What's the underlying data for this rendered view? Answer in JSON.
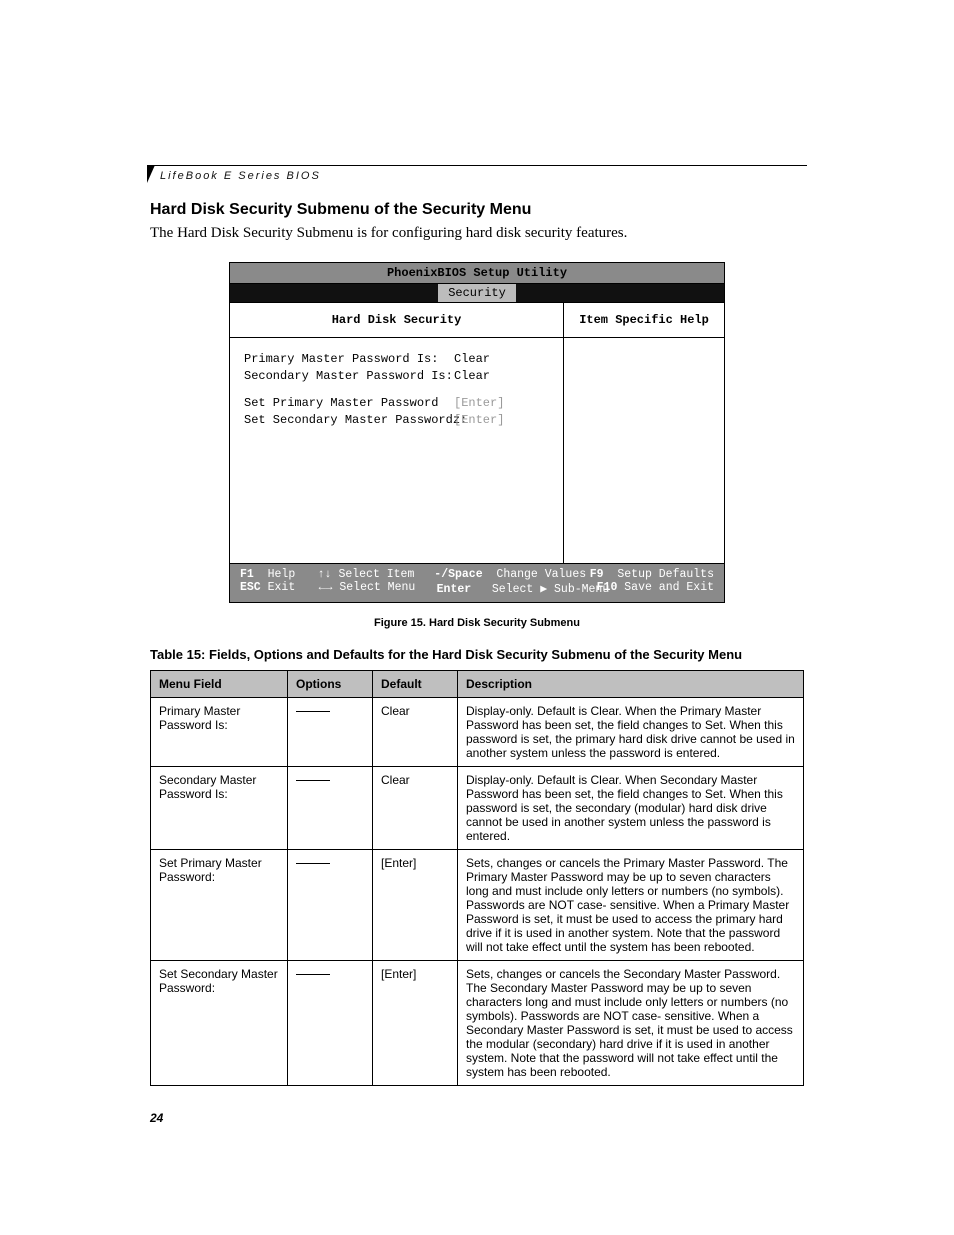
{
  "running_head": "LifeBook E Series BIOS",
  "section_title": "Hard Disk Security Submenu of the Security Menu",
  "intro": "The Hard Disk Security Submenu is for configuring hard disk security features.",
  "bios": {
    "utility_title": "PhoenixBIOS Setup Utility",
    "tab": "Security",
    "panel_title": "Hard Disk Security",
    "help_title": "Item Specific Help",
    "rows": [
      {
        "label": "Primary Master Password Is:",
        "value": "Clear",
        "muted": false
      },
      {
        "label": "Secondary Master Password Is:",
        "value": "Clear",
        "muted": false
      },
      {
        "label": "Set Primary Master Password",
        "value": "[Enter]",
        "muted": true
      },
      {
        "label": "Set Secondary Master Passwordz:",
        "value": "[Enter]",
        "muted": true
      }
    ],
    "footer": {
      "f1": "F1",
      "help": "Help",
      "esc": "ESC",
      "exit": "Exit",
      "updown": "↑↓",
      "select_item": "Select Item",
      "leftright": "←→",
      "select_menu": "Select Menu",
      "minus_space": "-/Space",
      "change_values": "Change Values",
      "enter": "Enter",
      "select_sub": "Select ▶ Sub-Menu",
      "f9": "F9",
      "setup_defaults": "Setup Defaults",
      "f10": "F10",
      "save_exit": "Save and Exit"
    }
  },
  "figure_caption": "Figure 15.   Hard Disk Security Submenu",
  "table_caption": "Table 15: Fields, Options and Defaults for the Hard Disk Security Submenu of the Security Menu",
  "table_headers": {
    "menu_field": "Menu Field",
    "options": "Options",
    "default": "Default",
    "description": "Description"
  },
  "table_rows": [
    {
      "menu_field": "Primary Master Password Is:",
      "default": "Clear",
      "description": "Display-only. Default is Clear. When the Primary Master Password has been set, the field changes to Set. When this password is set, the primary hard disk drive cannot be used in another system unless the password is entered."
    },
    {
      "menu_field": "Secondary Master Password Is:",
      "default": "Clear",
      "description": "Display-only. Default is Clear. When Secondary Master Password has been set, the field changes to Set. When this password is set, the secondary (modular) hard disk drive cannot be used in another system unless the password is entered."
    },
    {
      "menu_field": "Set Primary Master Password:",
      "default": "[Enter]",
      "description": "Sets, changes or cancels the Primary Master Password. The Primary Master Password may be up to seven characters long and must include only letters or numbers (no symbols). Passwords are NOT case- sensitive. When a Primary Master Password is set, it must be used to access the primary hard drive if it is used in another system. Note that the password will not take effect until the system has been rebooted."
    },
    {
      "menu_field": "Set Secondary Master Password:",
      "default": "[Enter]",
      "description": "Sets, changes or cancels the Secondary Master Password. The Secondary Master Password may be up to seven characters long and must include only letters or numbers (no symbols). Passwords are NOT case- sensitive. When a Secondary Master Password is set, it must be used to access the modular (secondary) hard drive if it is used in another system. Note that the password will not take effect until the system has been rebooted."
    }
  ],
  "page_number": "24"
}
